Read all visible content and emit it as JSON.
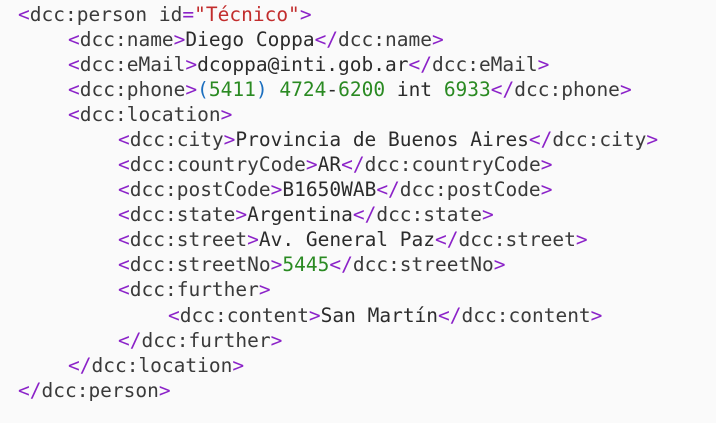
{
  "code": {
    "l1": {
      "el": "dcc:person",
      "attr_name": "id",
      "attr_value": "\"Técnico\""
    },
    "l2": {
      "el": "dcc:name",
      "text": "Diego Coppa"
    },
    "l3": {
      "el": "dcc:eMail",
      "text": "dcoppa@inti.gob.ar"
    },
    "l4": {
      "el": "dcc:phone",
      "p_open": "(",
      "n1": "5411",
      "p_close": ")",
      "n2": "4724",
      "dash": "-",
      "n3": "6200",
      "mid": "int",
      "n4": "6933"
    },
    "l5": {
      "el": "dcc:location"
    },
    "l6": {
      "el": "dcc:city",
      "text": "Provincia de Buenos Aires"
    },
    "l7": {
      "el": "dcc:countryCode",
      "text": "AR"
    },
    "l8": {
      "el": "dcc:postCode",
      "text": "B1650WAB"
    },
    "l9": {
      "el": "dcc:state",
      "text": "Argentina"
    },
    "l10": {
      "el": "dcc:street",
      "text": "Av. General Paz"
    },
    "l11": {
      "el": "dcc:streetNo",
      "num": "5445"
    },
    "l12": {
      "el": "dcc:further"
    },
    "l13": {
      "el": "dcc:content",
      "text": "San Martín"
    },
    "l14": {
      "el": "dcc:further"
    },
    "l15": {
      "el": "dcc:location"
    },
    "l16": {
      "el": "dcc:person"
    }
  }
}
